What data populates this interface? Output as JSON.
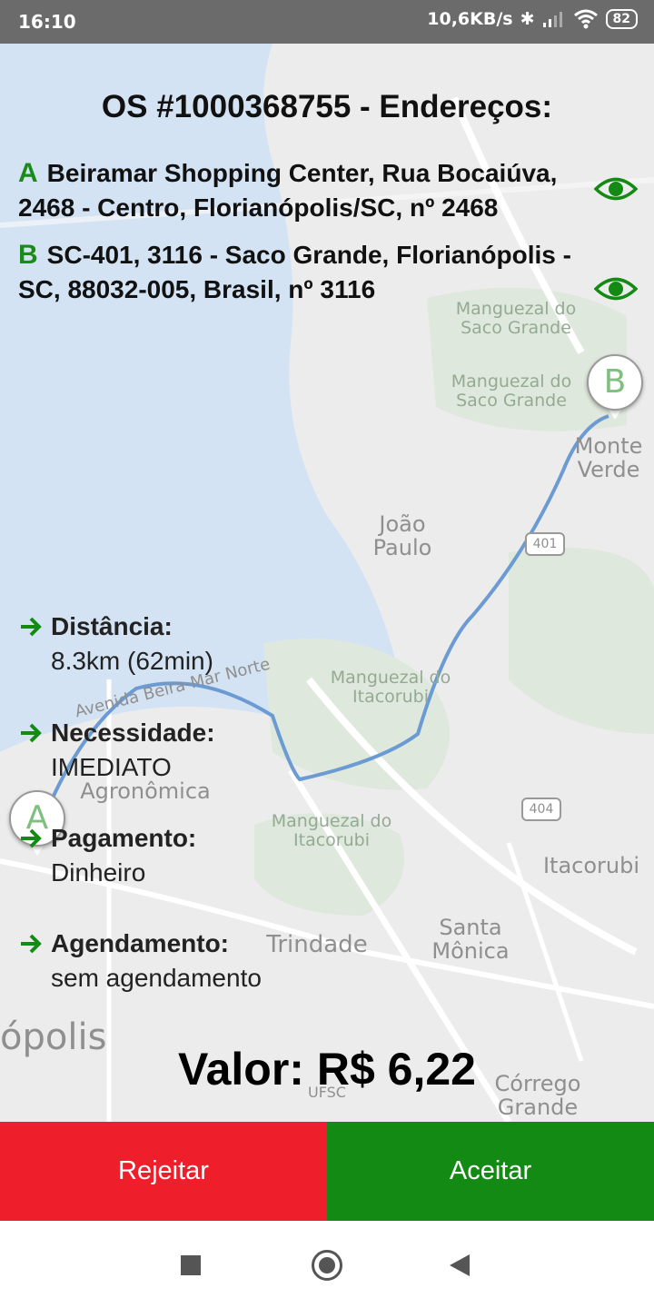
{
  "status_bar": {
    "time": "16:10",
    "network_speed": "10,6KB/s",
    "battery": "82"
  },
  "map": {
    "labels": {
      "manguezal_saco_grande_1": "Manguezal do Saco Grande",
      "manguezal_saco_grande_2": "Manguezal do Saco Grande",
      "monte_verde": "Monte Verde",
      "joao_paulo": "João Paulo",
      "route_401": "401",
      "manguezal_itacorubi_1": "Manguezal do Itacorubi",
      "beira_mar_norte": "Avenida Beira-Mar Norte",
      "agronomica": "Agronômica",
      "route_404": "404",
      "manguezal_itacorubi_2": "Manguezal do Itacorubi",
      "itacorubi": "Itacorubi",
      "trindade": "Trindade",
      "santa_monica": "Santa Mônica",
      "florianopolis": "ópolis",
      "corrego_grande": "Córrego Grande",
      "ufsc": "UFSC"
    },
    "pin_a": "A",
    "pin_b": "B"
  },
  "order": {
    "title": "OS #1000368755 - Endereços:",
    "address_a": {
      "letter": "A",
      "text": "Beiramar Shopping Center, Rua Bocaiúva, 2468 - Centro, Florianópolis/SC, nº 2468"
    },
    "address_b": {
      "letter": "B",
      "text": "SC-401, 3116 - Saco Grande, Florianópolis - SC, 88032-005, Brasil, nº 3116"
    },
    "info": [
      {
        "label": "Distância:",
        "value": "8.3km (62min)"
      },
      {
        "label": "Necessidade:",
        "value": "IMEDIATO"
      },
      {
        "label": "Pagamento:",
        "value": "Dinheiro"
      },
      {
        "label": "Agendamento:",
        "value": "sem agendamento"
      }
    ],
    "valor": "Valor: R$ 6,22"
  },
  "actions": {
    "reject": "Rejeitar",
    "accept": "Aceitar"
  },
  "colors": {
    "reject": "#ee1f2a",
    "accept": "#138a13",
    "accent_green": "#1a8a1a",
    "route": "#6b9bd2",
    "water": "#d4e3f3"
  }
}
